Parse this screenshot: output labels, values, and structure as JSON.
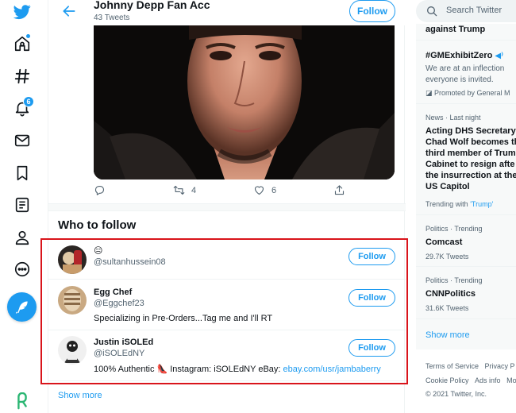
{
  "header": {
    "name": "Johnny Depp Fan Acc",
    "tweet_count": "43 Tweets",
    "follow_label": "Follow"
  },
  "tweet_actions": {
    "retweets": "4",
    "likes": "6"
  },
  "who_to_follow": {
    "title": "Who to follow",
    "show_more": "Show more",
    "accounts": [
      {
        "name": "😑",
        "handle": "@sultanhussein08",
        "bio": "",
        "follow_label": "Follow"
      },
      {
        "name": "Egg Chef",
        "handle": "@Eggchef23",
        "bio": "Specializing in Pre-Orders...Tag me and I'll RT",
        "follow_label": "Follow"
      },
      {
        "name": "Justin iSOLEd",
        "handle": "@iSOLEdNY",
        "bio": "100% Authentic 👠 Instagram: iSOLEdNY eBay: ",
        "bio_link": "ebay.com/usr/jambaberry",
        "follow_label": "Follow"
      }
    ]
  },
  "nav": {
    "notification_count": "6"
  },
  "sidebar": {
    "search_placeholder": "Search Twitter",
    "trend0_tail": "against Trump",
    "promo": {
      "hashtag": "#GMExhibitZero",
      "desc_line1": "We are at an inflection",
      "desc_line2": "everyone is invited.",
      "promoted": "Promoted by General M"
    },
    "news": {
      "meta": "News · Last night",
      "lines": [
        "Acting DHS Secretary",
        "Chad Wolf becomes th",
        "third member of Trum",
        "Cabinet to resign afte",
        "the insurrection at the",
        "US Capitol"
      ],
      "trending_prefix": "Trending with ",
      "trending_link": "'Trump'"
    },
    "trends": [
      {
        "meta": "Politics · Trending",
        "name": "Comcast",
        "count": "29.7K Tweets"
      },
      {
        "meta": "Politics · Trending",
        "name": "CNNPolitics",
        "count": "31.6K Tweets"
      }
    ],
    "show_more": "Show more",
    "footer": {
      "line1a": "Terms of Service",
      "line1b": "Privacy P",
      "line2a": "Cookie Policy",
      "line2b": "Ads info",
      "line2c": "More",
      "line3": "© 2021 Twitter, Inc."
    }
  },
  "colors": {
    "accent": "#1d9bf0",
    "highlight": "#d9141b"
  }
}
